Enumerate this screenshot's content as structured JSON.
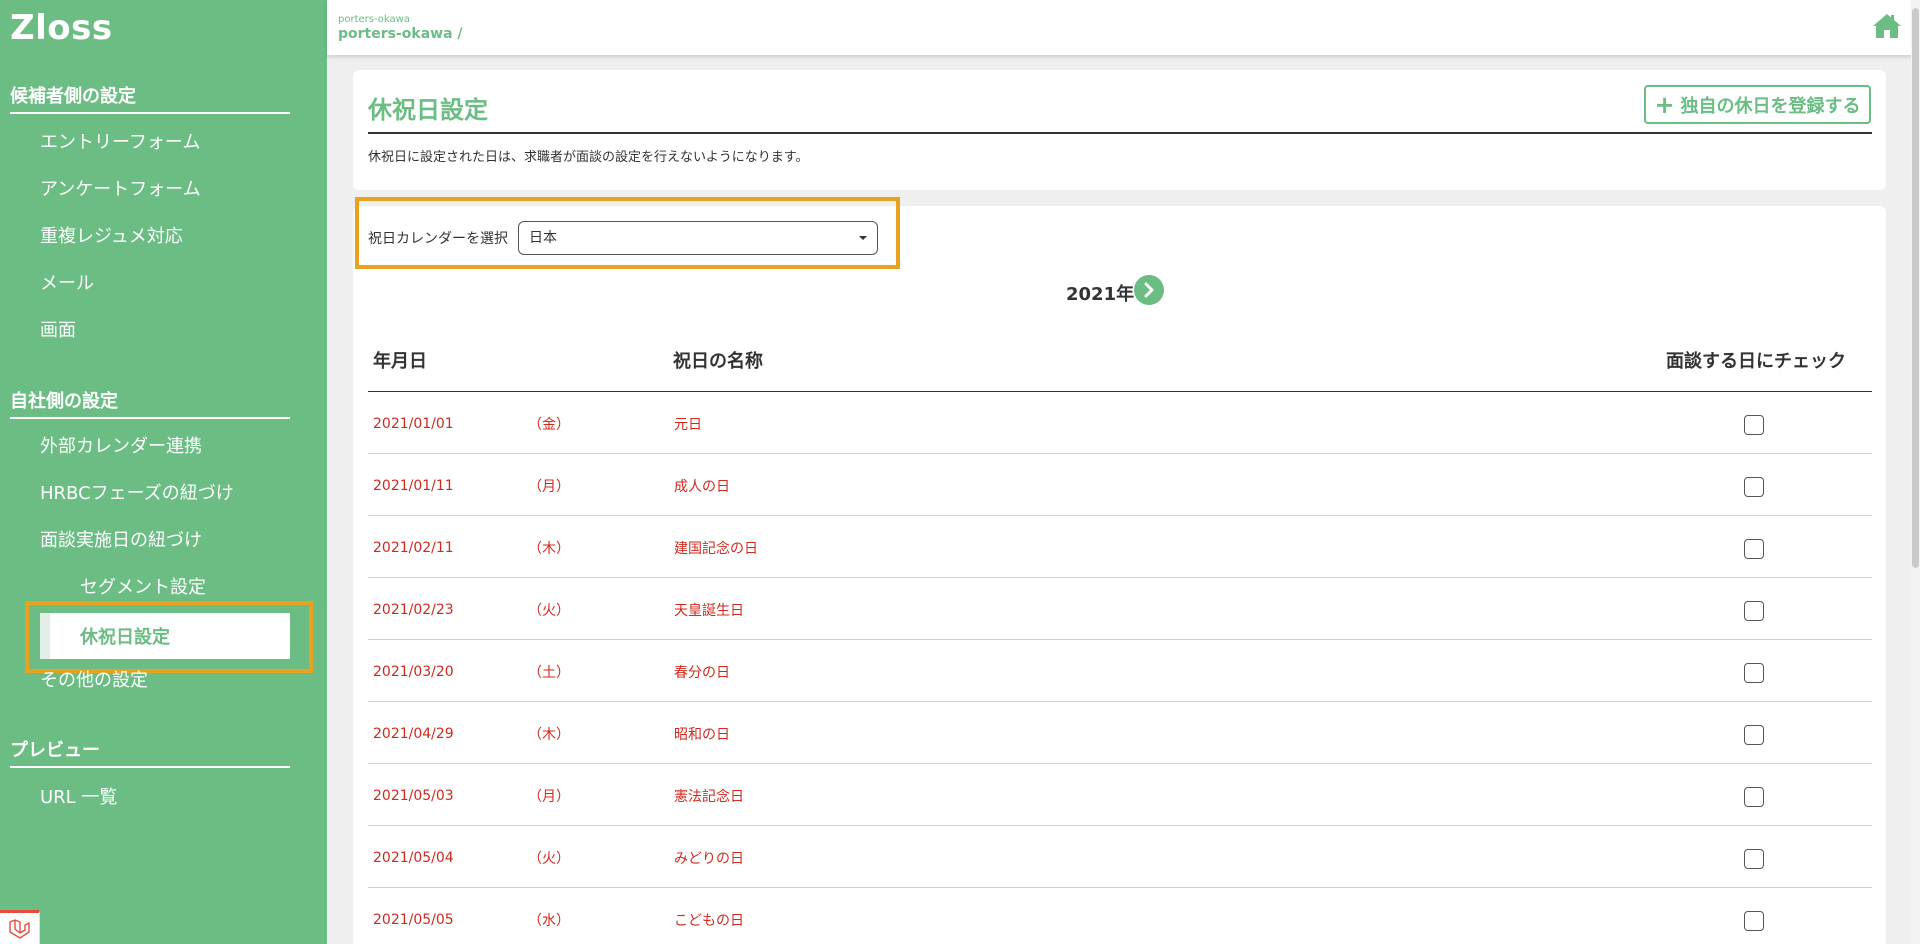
{
  "sidebar": {
    "logo": "Zloss",
    "sections": [
      {
        "title": "候補者側の設定",
        "items": [
          "エントリーフォーム",
          "アンケートフォーム",
          "重複レジュメ対応",
          "メール",
          "画面"
        ]
      },
      {
        "title": "自社側の設定",
        "items": [
          "外部カレンダー連携",
          "HRBCフェーズの紐づけ",
          "面談実施日の紐づけ",
          "セグメント設定",
          "休祝日設定",
          "その他の設定"
        ]
      },
      {
        "title": "プレビュー",
        "items": [
          "URL 一覧"
        ]
      }
    ],
    "active_item": "休祝日設定"
  },
  "header": {
    "breadcrumb_small": "porters-okawa",
    "breadcrumb_main": "porters-okawa /",
    "home_icon": "home-icon"
  },
  "page": {
    "title": "休祝日設定",
    "add_button": "独自の休日を登録する",
    "description": "休祝日に設定された日は、求職者が面談の設定を行えないようになります。",
    "calendar_label": "祝日カレンダーを選択",
    "calendar_value": "日本",
    "year": "2021年"
  },
  "table": {
    "headers": {
      "date": "年月日",
      "name": "祝日の名称",
      "check": "面談する日にチェック"
    },
    "rows": [
      {
        "date": "2021/01/01",
        "dow": "（金）",
        "name": "元日"
      },
      {
        "date": "2021/01/11",
        "dow": "（月）",
        "name": "成人の日"
      },
      {
        "date": "2021/02/11",
        "dow": "（木）",
        "name": "建国記念の日"
      },
      {
        "date": "2021/02/23",
        "dow": "（火）",
        "name": "天皇誕生日"
      },
      {
        "date": "2021/03/20",
        "dow": "（土）",
        "name": "春分の日"
      },
      {
        "date": "2021/04/29",
        "dow": "（木）",
        "name": "昭和の日"
      },
      {
        "date": "2021/05/03",
        "dow": "（月）",
        "name": "憲法記念日"
      },
      {
        "date": "2021/05/04",
        "dow": "（火）",
        "name": "みどりの日"
      },
      {
        "date": "2021/05/05",
        "dow": "（水）",
        "name": "こどもの日"
      }
    ]
  },
  "colors": {
    "accent": "#6bbd84",
    "highlight": "#e9a21f",
    "holiday_text": "#d02a1e"
  }
}
